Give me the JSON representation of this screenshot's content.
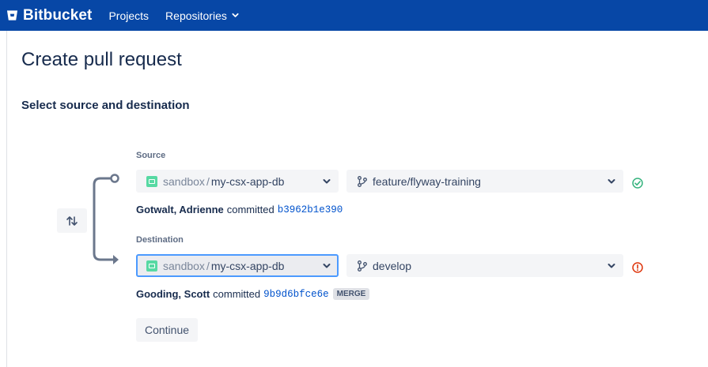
{
  "header": {
    "product": "Bitbucket",
    "nav": [
      {
        "label": "Projects"
      },
      {
        "label": "Repositories"
      }
    ]
  },
  "page": {
    "title": "Create pull request",
    "subtitle": "Select source and destination"
  },
  "source": {
    "label": "Source",
    "repo_project": "sandbox",
    "repo_separator": "/",
    "repo_name": "my-csx-app-db",
    "branch": "feature/flyway-training",
    "status": "ok",
    "commit": {
      "author": "Gotwalt, Adrienne",
      "verb": "committed",
      "hash": "b3962b1e390"
    }
  },
  "destination": {
    "label": "Destination",
    "repo_project": "sandbox",
    "repo_separator": "/",
    "repo_name": "my-csx-app-db",
    "branch": "develop",
    "status": "error",
    "commit": {
      "author": "Gooding, Scott",
      "verb": "committed",
      "hash": "9b9d6bfce6e",
      "badge": "MERGE"
    }
  },
  "actions": {
    "continue_label": "Continue"
  },
  "colors": {
    "header_bg": "#0747a6",
    "repo_icon": "#57d9a3",
    "success": "#36b37e",
    "error": "#de350b",
    "link": "#0052cc"
  },
  "icons": {
    "logo": "bitbucket-logo-icon",
    "swap": "swap-arrows-icon",
    "branch": "branch-icon",
    "ok": "check-circle-icon",
    "error": "error-circle-icon"
  }
}
